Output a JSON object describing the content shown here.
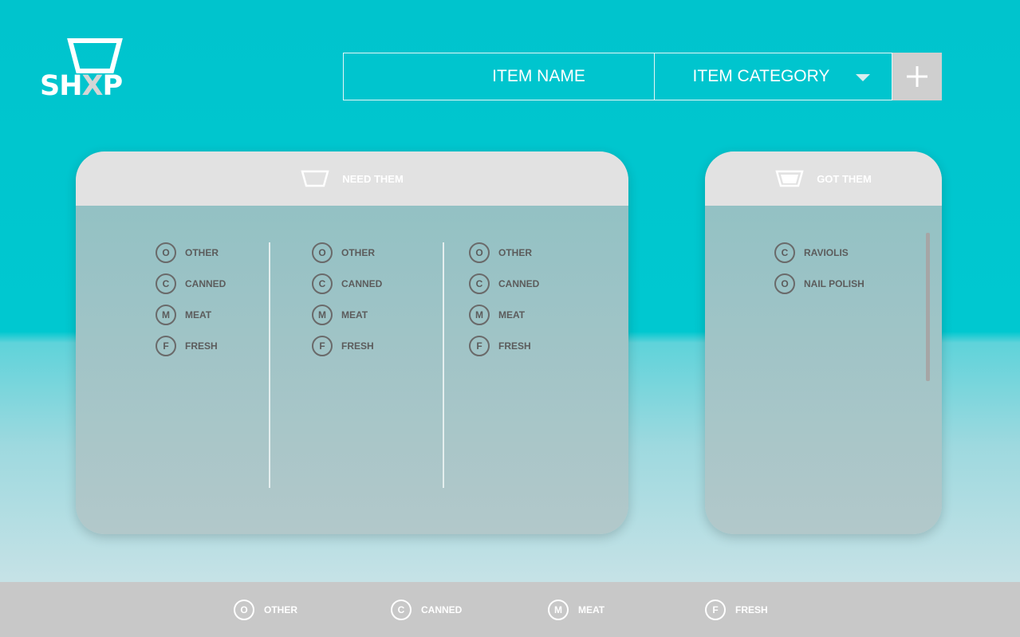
{
  "brand": {
    "logo_prefix": "SH",
    "logo_x": "X",
    "logo_suffix": "P"
  },
  "entry": {
    "item_name_placeholder": "ITEM NAME",
    "category_label": "ITEM CATEGORY",
    "add_button_label": "+"
  },
  "need_panel": {
    "title": "NEED THEM",
    "columns": [
      [
        {
          "badge": "O",
          "label": "OTHER"
        },
        {
          "badge": "C",
          "label": "CANNED"
        },
        {
          "badge": "M",
          "label": "MEAT"
        },
        {
          "badge": "F",
          "label": "FRESH"
        }
      ],
      [
        {
          "badge": "O",
          "label": "OTHER"
        },
        {
          "badge": "C",
          "label": "CANNED"
        },
        {
          "badge": "M",
          "label": "MEAT"
        },
        {
          "badge": "F",
          "label": "FRESH"
        }
      ],
      [
        {
          "badge": "O",
          "label": "OTHER"
        },
        {
          "badge": "C",
          "label": "CANNED"
        },
        {
          "badge": "M",
          "label": "MEAT"
        },
        {
          "badge": "F",
          "label": "FRESH"
        }
      ]
    ]
  },
  "got_panel": {
    "title": "GOT THEM",
    "items": [
      {
        "badge": "C",
        "label": "RAVIOLIS"
      },
      {
        "badge": "O",
        "label": "NAIL POLISH"
      }
    ]
  },
  "legend": [
    {
      "badge": "O",
      "label": "OTHER"
    },
    {
      "badge": "C",
      "label": "CANNED"
    },
    {
      "badge": "M",
      "label": "MEAT"
    },
    {
      "badge": "F",
      "label": "FRESH"
    }
  ],
  "colors": {
    "accent": "#00c4cd",
    "panel_header": "#e2e2e2",
    "footer": "#c8c8c8"
  },
  "icons": {
    "list_icon": "basket-outline-icon",
    "got_icon": "basket-filled-icon",
    "add_icon": "plus-icon",
    "dropdown_icon": "chevron-down-icon"
  }
}
